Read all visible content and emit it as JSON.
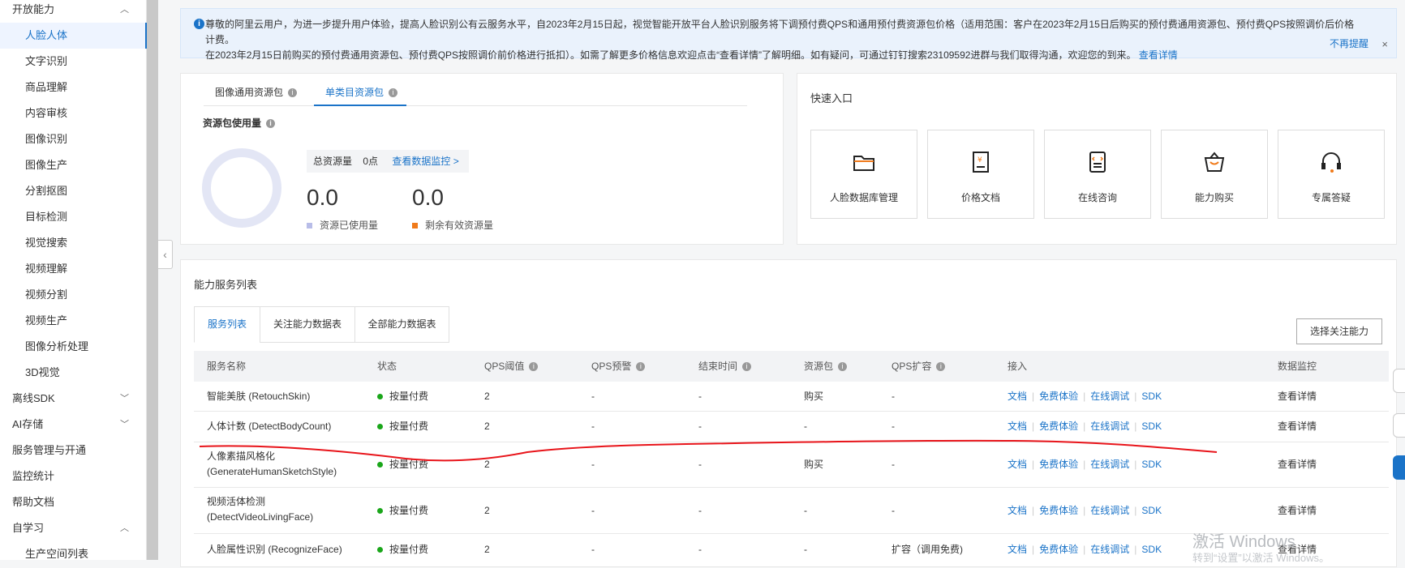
{
  "sidebar": {
    "items": [
      {
        "label": "开放能力",
        "chev": "up"
      },
      {
        "label": "人脸人体"
      },
      {
        "label": "文字识别"
      },
      {
        "label": "商品理解"
      },
      {
        "label": "内容审核"
      },
      {
        "label": "图像识别"
      },
      {
        "label": "图像生产"
      },
      {
        "label": "分割抠图"
      },
      {
        "label": "目标检测"
      },
      {
        "label": "视觉搜索"
      },
      {
        "label": "视频理解"
      },
      {
        "label": "视频分割"
      },
      {
        "label": "视频生产"
      },
      {
        "label": "图像分析处理"
      },
      {
        "label": "3D视觉"
      },
      {
        "label": "离线SDK",
        "chev": "down"
      },
      {
        "label": "AI存储",
        "chev": "down"
      },
      {
        "label": "服务管理与开通"
      },
      {
        "label": "监控统计"
      },
      {
        "label": "帮助文档"
      },
      {
        "label": "自学习",
        "chev": "up"
      },
      {
        "label": "生产空间列表"
      }
    ]
  },
  "notice": {
    "line1": "尊敬的阿里云用户，为进一步提升用户体验，提高人脸识别公有云服务水平，自2023年2月15日起，视觉智能开放平台人脸识别服务将下调预付费QPS和通用预付费资源包价格（适用范围：客户在2023年2月15日后购买的预付费通用资源包、预付费QPS按照调价后价格计费。",
    "line2": "在2023年2月15日前购买的预付费通用资源包、预付费QPS按照调价前价格进行抵扣）。如需了解更多价格信息欢迎点击“查看详情”了解明细。如有疑问，可通过钉钉搜索23109592进群与我们取得沟通，欢迎您的到来。",
    "details_link": "查看详情",
    "no_remind": "不再提醒",
    "close": "×"
  },
  "resource": {
    "tabs": [
      "图像通用资源包",
      "单类目资源包"
    ],
    "usage_title": "资源包使用量",
    "total_label": "总资源量",
    "total_value": "0点",
    "monitor_link": "查看数据监控 >",
    "used_value": "0.0",
    "remaining_value": "0.0",
    "used_label": "资源已使用量",
    "remaining_label": "剩余有效资源量"
  },
  "quick": {
    "title": "快速入口",
    "entries": [
      "人脸数据库管理",
      "价格文档",
      "在线咨询",
      "能力购买",
      "专属答疑"
    ]
  },
  "services": {
    "title": "能力服务列表",
    "tabs": [
      "服务列表",
      "关注能力数据表",
      "全部能力数据表"
    ],
    "select_button": "选择关注能力",
    "headers": [
      "服务名称",
      "状态",
      "QPS阈值",
      "QPS预警",
      "结束时间",
      "资源包",
      "QPS扩容",
      "接入",
      "数据监控"
    ],
    "rows": [
      {
        "name": "智能美肤 (RetouchSkin)",
        "status": "按量付费",
        "qps": "2",
        "warn": "-",
        "end": "-",
        "pkg": "购买",
        "expand": "-",
        "monitor": "查看详情"
      },
      {
        "name": "人体计数 (DetectBodyCount)",
        "status": "按量付费",
        "qps": "2",
        "warn": "-",
        "end": "-",
        "pkg": "-",
        "expand": "-",
        "monitor": "查看详情"
      },
      {
        "name": "人像素描风格化 (GenerateHumanSketchStyle)",
        "status": "按量付费",
        "qps": "2",
        "warn": "-",
        "end": "-",
        "pkg": "购买",
        "expand": "-",
        "monitor": "查看详情"
      },
      {
        "name": "视频活体检测 (DetectVideoLivingFace)",
        "status": "按量付费",
        "qps": "2",
        "warn": "-",
        "end": "-",
        "pkg": "-",
        "expand": "-",
        "monitor": "查看详情"
      },
      {
        "name": "人脸属性识别 (RecognizeFace)",
        "status": "按量付费",
        "qps": "2",
        "warn": "-",
        "end": "-",
        "pkg": "-",
        "expand": "扩容（调用免费)",
        "monitor": "查看详情"
      }
    ],
    "access_links": [
      "文档",
      "免费体验",
      "在线调试",
      "SDK"
    ]
  },
  "watermark": {
    "line1": "激活 Windows",
    "line2": "转到“设置”以激活 Windows。"
  },
  "colors": {
    "accent": "#1a73c8",
    "annotation": "#e8141a",
    "status_green": "#1aa61a",
    "remaining": "#f07a1a",
    "used": "#b8bde8"
  }
}
